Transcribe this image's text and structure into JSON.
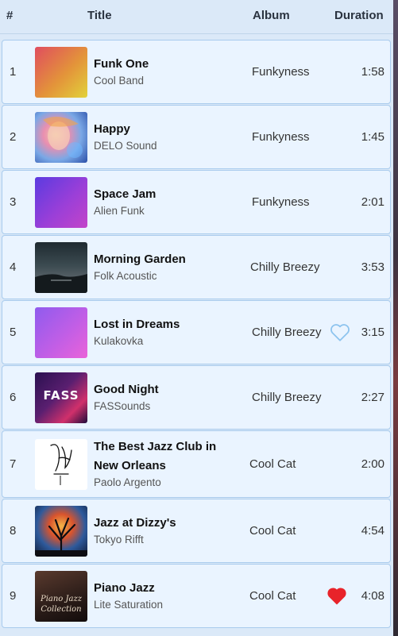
{
  "header": {
    "num": "#",
    "title": "Title",
    "album": "Album",
    "duration": "Duration"
  },
  "tracks": [
    {
      "num": "1",
      "title": "Funk One",
      "artist": "Cool Band",
      "album": "Funkyness",
      "duration": "1:58",
      "art": "gradient-orange-yellow"
    },
    {
      "num": "2",
      "title": "Happy",
      "artist": "DELO Sound",
      "album": "Funkyness",
      "duration": "1:45",
      "art": "photo-colorful-face"
    },
    {
      "num": "3",
      "title": "Space Jam",
      "artist": "Alien Funk",
      "album": "Funkyness",
      "duration": "2:01",
      "art": "gradient-purple-magenta"
    },
    {
      "num": "4",
      "title": "Morning Garden",
      "artist": "Folk Acoustic",
      "album": "Chilly Breezy",
      "duration": "3:53",
      "art": "photo-dark-landscape"
    },
    {
      "num": "5",
      "title": "Lost in Dreams",
      "artist": "Kulakovka",
      "album": "Chilly Breezy",
      "duration": "3:15",
      "art": "gradient-violet-pink",
      "favorite": false
    },
    {
      "num": "6",
      "title": "Good Night",
      "artist": "FASSounds",
      "album": "Chilly Breezy",
      "duration": "2:27",
      "art": "fass-logo-art",
      "art_text": "FASS"
    },
    {
      "num": "7",
      "title": "The Best Jazz Club in New Orleans",
      "artist": "Paolo Argento",
      "album": "Cool Cat",
      "duration": "2:00",
      "art": "signature-art"
    },
    {
      "num": "8",
      "title": "Jazz at Dizzy's",
      "artist": "Tokyo Rifft",
      "album": "Cool Cat",
      "duration": "4:54",
      "art": "photo-tree-night"
    },
    {
      "num": "9",
      "title": "Piano Jazz",
      "artist": "Lite Saturation",
      "album": "Cool Cat",
      "duration": "4:08",
      "art": "piano-jazz-collection-art",
      "art_text_1": "Piano Jazz",
      "art_text_2": "Collection",
      "favorite": true
    }
  ],
  "colors": {
    "row_bg": "#eaf4ff",
    "row_border": "#a9cbed",
    "heart_filled": "#e8232a",
    "heart_outline": "#8cc3ee"
  }
}
